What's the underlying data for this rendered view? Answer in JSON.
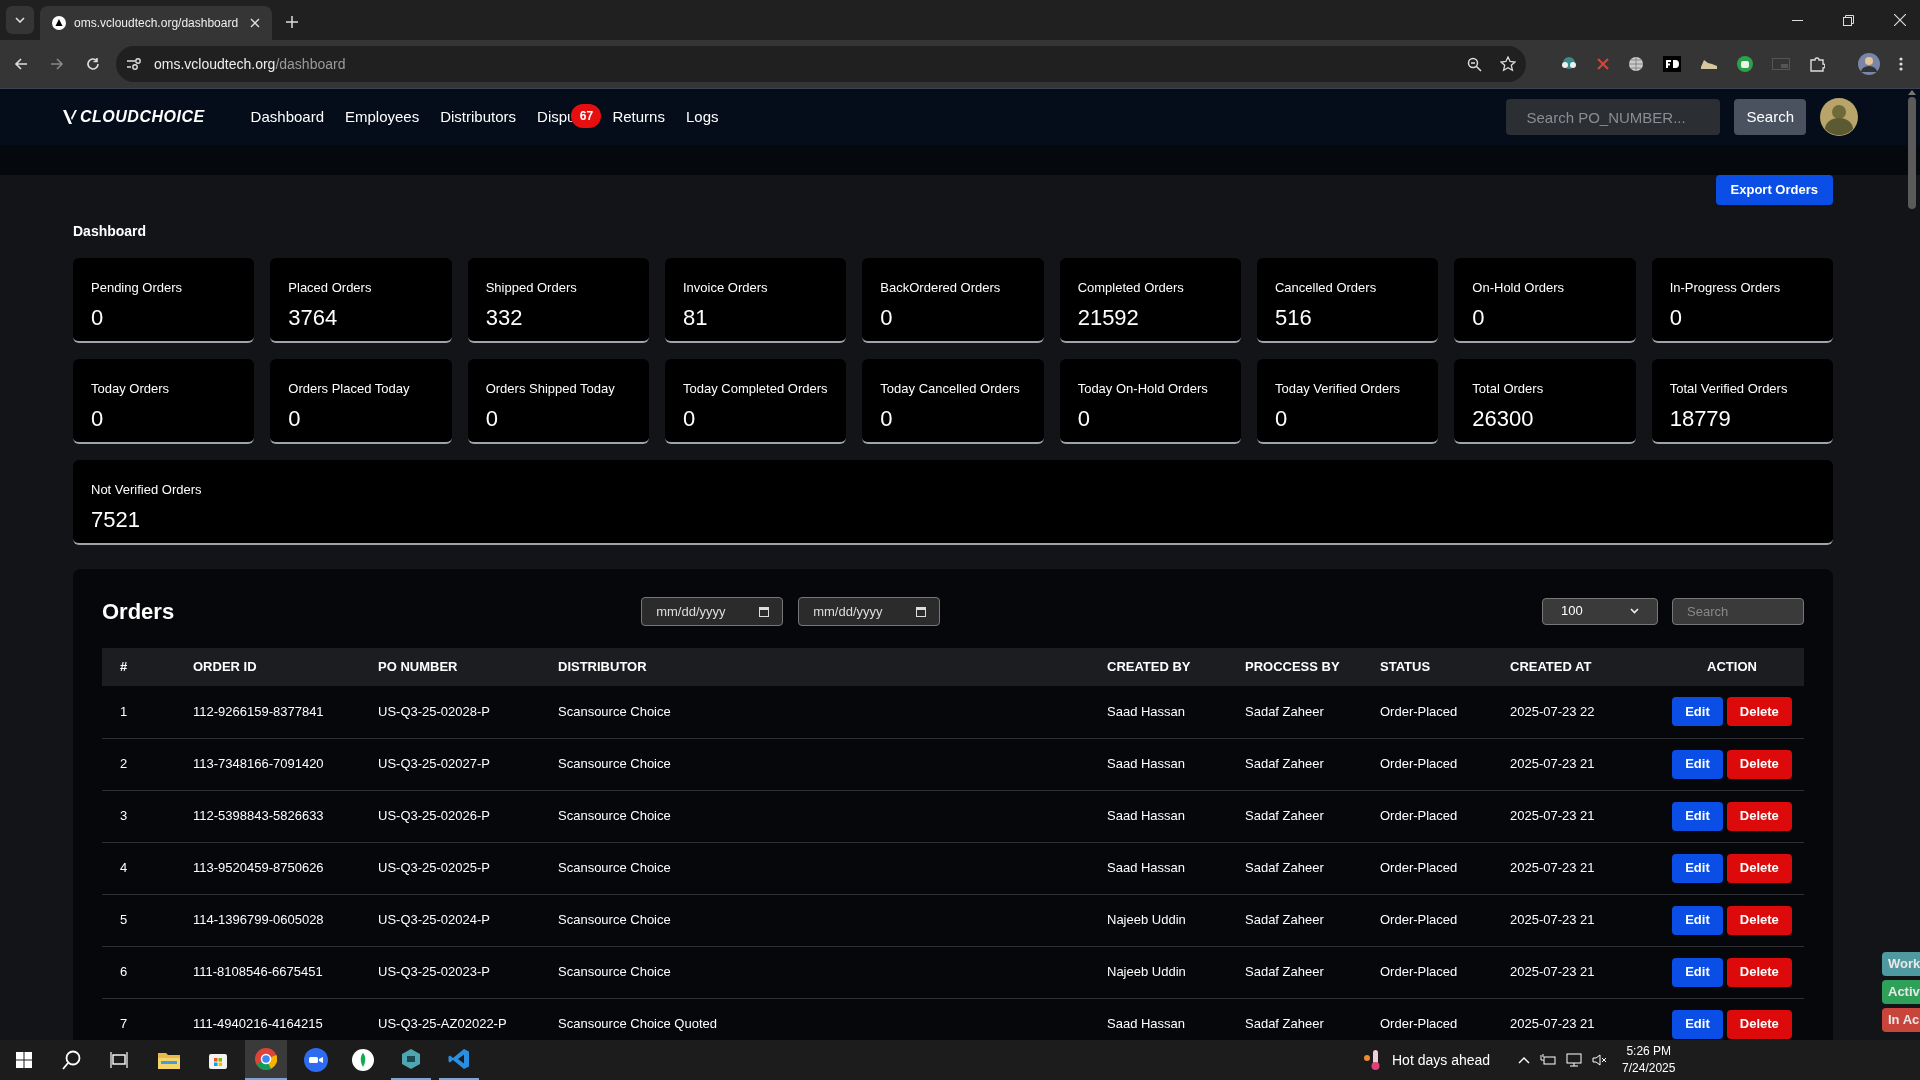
{
  "browser": {
    "tab_title": "oms.vcloudtech.org/dashboard",
    "url_host": "oms.vcloudtech.org",
    "url_path": "/dashboard"
  },
  "nav": {
    "logo": "CLOUDCHOICE",
    "items": [
      {
        "label": "Dashboard"
      },
      {
        "label": "Employees"
      },
      {
        "label": "Distributors"
      },
      {
        "label": "Dispu",
        "badge": "67"
      },
      {
        "label": "Returns"
      },
      {
        "label": "Logs"
      }
    ],
    "search_placeholder": "Search PO_NUMBER...",
    "search_button": "Search"
  },
  "export_button": "Export Orders",
  "section_title": "Dashboard",
  "stats": [
    {
      "label": "Pending Orders",
      "value": "0",
      "kind": "normal"
    },
    {
      "label": "Placed Orders",
      "value": "3764",
      "kind": "normal"
    },
    {
      "label": "Shipped Orders",
      "value": "332",
      "kind": "normal"
    },
    {
      "label": "Invoice Orders",
      "value": "81",
      "kind": "normal"
    },
    {
      "label": "BackOrdered Orders",
      "value": "0",
      "kind": "normal"
    },
    {
      "label": "Completed Orders",
      "value": "21592",
      "kind": "normal"
    },
    {
      "label": "Cancelled Orders",
      "value": "516",
      "kind": "normal"
    },
    {
      "label": "On-Hold Orders",
      "value": "0",
      "kind": "normal"
    },
    {
      "label": "In-Progress Orders",
      "value": "0",
      "kind": "normal"
    },
    {
      "label": "Today Orders",
      "value": "0",
      "kind": "normal"
    },
    {
      "label": "Orders Placed Today",
      "value": "0",
      "kind": "normal"
    },
    {
      "label": "Orders Shipped Today",
      "value": "0",
      "kind": "normal"
    },
    {
      "label": "Today Completed Orders",
      "value": "0",
      "kind": "normal"
    },
    {
      "label": "Today Cancelled Orders",
      "value": "0",
      "kind": "normal"
    },
    {
      "label": "Today On-Hold Orders",
      "value": "0",
      "kind": "normal"
    },
    {
      "label": "Today Verified Orders",
      "value": "0",
      "kind": "normal"
    },
    {
      "label": "Total Orders",
      "value": "26300",
      "kind": "normal"
    },
    {
      "label": "Total Verified Orders",
      "value": "18779",
      "kind": "normal"
    },
    {
      "label": "Not Verified Orders",
      "value": "7521",
      "kind": "wide"
    }
  ],
  "orders": {
    "title": "Orders",
    "date_from_placeholder": "mm/dd/yyyy",
    "date_to_placeholder": "mm/dd/yyyy",
    "page_size": "100",
    "search_placeholder": "Search",
    "columns": [
      "#",
      "ORDER ID",
      "PO NUMBER",
      "DISTRIBUTOR",
      "CREATED BY",
      "PROCCESS BY",
      "STATUS",
      "CREATED AT",
      "ACTION"
    ],
    "rows": [
      {
        "cells": [
          "1",
          "112-9266159-8377841",
          "US-Q3-25-02028-P",
          "Scansource Choice",
          "Saad Hassan",
          "Sadaf Zaheer",
          "Order-Placed",
          "2025-07-23 22"
        ],
        "edit": "Edit",
        "delete": "Delete"
      },
      {
        "cells": [
          "2",
          "113-7348166-7091420",
          "US-Q3-25-02027-P",
          "Scansource Choice",
          "Saad Hassan",
          "Sadaf Zaheer",
          "Order-Placed",
          "2025-07-23 21"
        ],
        "edit": "Edit",
        "delete": "Delete"
      },
      {
        "cells": [
          "3",
          "112-5398843-5826633",
          "US-Q3-25-02026-P",
          "Scansource Choice",
          "Saad Hassan",
          "Sadaf Zaheer",
          "Order-Placed",
          "2025-07-23 21"
        ],
        "edit": "Edit",
        "delete": "Delete"
      },
      {
        "cells": [
          "4",
          "113-9520459-8750626",
          "US-Q3-25-02025-P",
          "Scansource Choice",
          "Saad Hassan",
          "Sadaf Zaheer",
          "Order-Placed",
          "2025-07-23 21"
        ],
        "edit": "Edit",
        "delete": "Delete"
      },
      {
        "cells": [
          "5",
          "114-1396799-0605028",
          "US-Q3-25-02024-P",
          "Scansource Choice",
          "Najeeb Uddin",
          "Sadaf Zaheer",
          "Order-Placed",
          "2025-07-23 21"
        ],
        "edit": "Edit",
        "delete": "Delete"
      },
      {
        "cells": [
          "6",
          "111-8108546-6675451",
          "US-Q3-25-02023-P",
          "Scansource Choice",
          "Najeeb Uddin",
          "Sadaf Zaheer",
          "Order-Placed",
          "2025-07-23 21"
        ],
        "edit": "Edit",
        "delete": "Delete"
      },
      {
        "cells": [
          "7",
          "111-4940216-4164215",
          "US-Q3-25-AZ02022-P",
          "Scansource Choice Quoted",
          "Saad Hassan",
          "Sadaf Zaheer",
          "Order-Placed",
          "2025-07-23 21"
        ],
        "edit": "Edit",
        "delete": "Delete"
      }
    ]
  },
  "side_widgets": [
    {
      "label": "Work",
      "color": "#4f9aa0"
    },
    {
      "label": "Activ",
      "color": "#2ea05a"
    },
    {
      "label": "In Ac",
      "color": "#c8453c"
    }
  ],
  "taskbar": {
    "weather": "Hot days ahead",
    "time": "5:26 PM",
    "date": "7/24/2025"
  }
}
